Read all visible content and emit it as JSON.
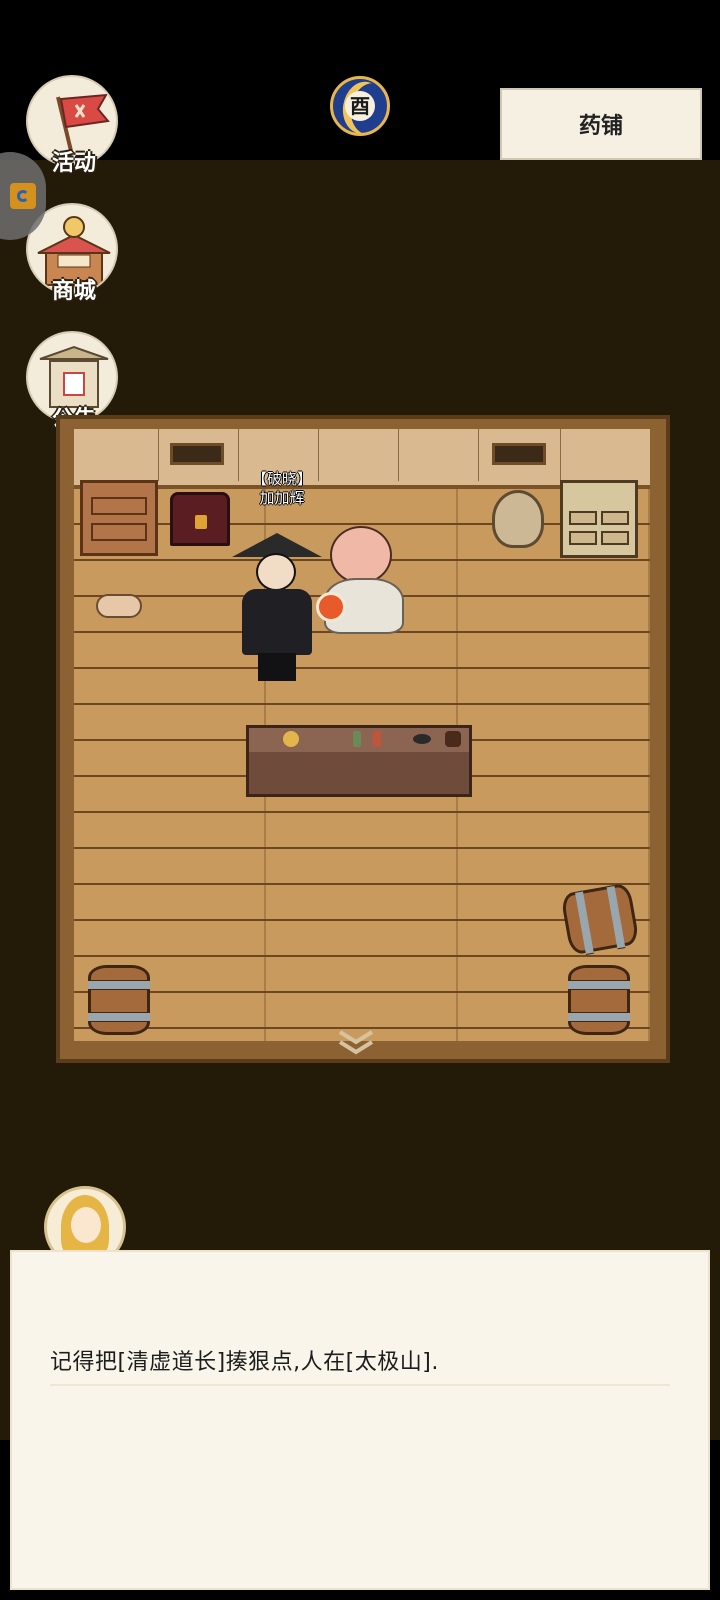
{
  "header": {
    "location_title": "药铺",
    "time_badge_glyph": "酉"
  },
  "side_menu": {
    "items": [
      {
        "label": "活动",
        "icon": "flag-icon"
      },
      {
        "label": "商城",
        "icon": "shop-icon"
      },
      {
        "label": "公告",
        "icon": "notice-gate-icon"
      }
    ]
  },
  "scene": {
    "npc_name_line1": "【破晓】",
    "npc_name_line2": "加加辉"
  },
  "dialog": {
    "text": "记得把[清虚道长]揍狠点,人在[太极山]."
  },
  "colors": {
    "background": "#231a08",
    "floor": "#c99a5e",
    "dialog_bg": "#faf5ea"
  }
}
